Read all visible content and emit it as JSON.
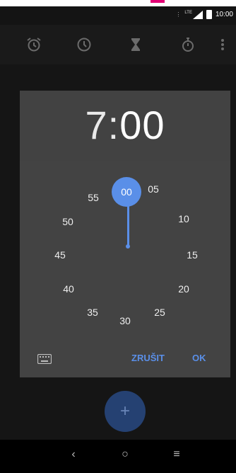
{
  "status_bar": {
    "time": "10:00",
    "network": "LTE"
  },
  "toolbar": {
    "tabs": [
      {
        "icon": "alarm-icon"
      },
      {
        "icon": "clock-icon"
      },
      {
        "icon": "timer-icon"
      },
      {
        "icon": "stopwatch-icon"
      }
    ],
    "overflow_icon": "more-vert-icon"
  },
  "time_picker": {
    "hours": "7",
    "separator": ":",
    "minutes": "00",
    "selected_minute": "00",
    "dial_numbers": [
      "05",
      "10",
      "15",
      "20",
      "25",
      "30",
      "35",
      "40",
      "45",
      "50",
      "55"
    ],
    "cancel_label": "ZRUŠIT",
    "ok_label": "OK",
    "accent_color": "#5a8fe8"
  },
  "fab": {
    "label": "+"
  },
  "navigation": {
    "back": "‹",
    "home": "○",
    "recents": "≡"
  }
}
